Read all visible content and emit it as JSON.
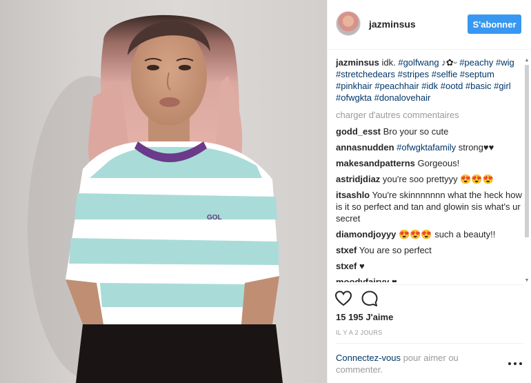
{
  "post": {
    "username": "jazminsus",
    "follow_label": "S'abonner",
    "caption": {
      "user": "jazminsus",
      "text": "idk.",
      "tags_line1": "#golfwang",
      "emoji1": "♪✿ᵕ",
      "tag_peachy": "#peachy",
      "tags_rest": "#wig #stretchedears #stripes #selfie #septum #pinkhair #peachhair #idk #ootd #basic #girl #ofwgkta #donalovehair"
    },
    "load_more": "charger d'autres commentaires",
    "comments": [
      {
        "user": "godd_esst",
        "text": "Bro your so cute"
      },
      {
        "user": "annasnudden",
        "tag": "#ofwgktafamily",
        "text": "strong♥︎♥︎"
      },
      {
        "user": "makesandpatterns",
        "text": "Gorgeous!"
      },
      {
        "user": "astridjdiaz",
        "text": "you're soo prettyyy 😍😍😍"
      },
      {
        "user": "itsashlo",
        "text": "You're skinnnnnnn what the heck how is it so perfect and tan and glowin sis what's ur secret"
      },
      {
        "user": "diamondjoyyy",
        "text": "😍😍😍 such a beauty!!"
      },
      {
        "user": "stxef",
        "text": "You are so perfect"
      },
      {
        "user": "stxef",
        "text": "♥︎"
      },
      {
        "user": "moodyfairyy",
        "text": "♥"
      }
    ],
    "likes": "15 195 J'aime",
    "time": "IL Y A 2 JOURS",
    "login_link": "Connectez-vous",
    "login_text": " pour aimer ou commenter."
  },
  "icons": {
    "like": "heart-icon",
    "comment": "comment-bubble-icon",
    "more": "more-options-icon"
  },
  "colors": {
    "follow_button": "#3897f0",
    "link": "#003569",
    "muted": "#999999"
  }
}
